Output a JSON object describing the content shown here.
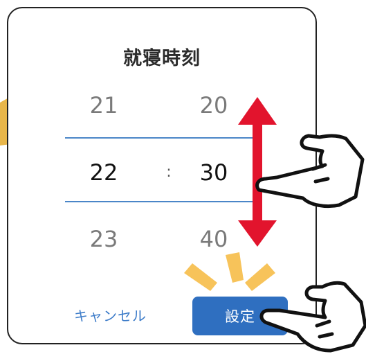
{
  "dialog": {
    "title": "就寝時刻",
    "picker": {
      "hours": [
        "21",
        "22",
        "23"
      ],
      "minutes": [
        "20",
        "30",
        "40"
      ],
      "selected_hour": "22",
      "selected_minute": "30",
      "separator": ":"
    },
    "cancel_label": "キャンセル",
    "set_label": "設定"
  },
  "colors": {
    "accent": "#2f6fc0",
    "selection_line": "#4a86c8",
    "arrow": "#e2142d",
    "highlight": "#f7c35a",
    "corner_arrow": "#e8b64a"
  },
  "icons": {
    "scroll_arrow": "double-vertical-arrow-icon",
    "swipe_hand": "pointing-hand-icon",
    "tap_hand": "pointing-hand-icon",
    "tap_burst": "burst-highlight-icon",
    "corner_arrow": "arrow-icon"
  }
}
